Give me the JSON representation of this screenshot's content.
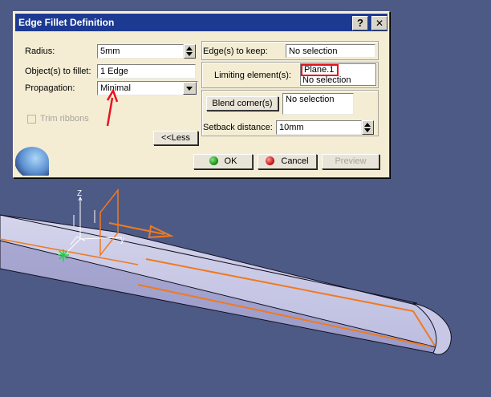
{
  "dialog": {
    "title": "Edge Fillet Definition",
    "help_label": "?",
    "close_label": "✕",
    "radius_label": "Radius:",
    "radius_value": "5mm",
    "objects_label": "Object(s) to fillet:",
    "objects_value": "1 Edge",
    "propagation_label": "Propagation:",
    "propagation_value": "Minimal",
    "trim_ribbons_label": "Trim ribbons",
    "less_button": "<<Less",
    "edges_keep_label": "Edge(s) to keep:",
    "edges_keep_value": "No selection",
    "limiting_label": "Limiting element(s):",
    "limiting_items": [
      "Plane.1",
      "No selection"
    ],
    "blend_button": "Blend corner(s)",
    "blend_value": "No selection",
    "setback_label": "Setback distance:",
    "setback_value": "10mm",
    "ok_label": "OK",
    "cancel_label": "Cancel",
    "preview_label": "Preview"
  },
  "viewport": {
    "axis_labels": {
      "z": "Z",
      "y": "y"
    }
  },
  "colors": {
    "background": "#4e5a86",
    "titlebar": "#1d3a93",
    "annotation_arrow": "#e8141c",
    "highlight_box": "#e8141c",
    "edge_highlight": "#f07a20",
    "ok_icon": "#1a9a1a",
    "cancel_icon": "#cc1a1a"
  }
}
